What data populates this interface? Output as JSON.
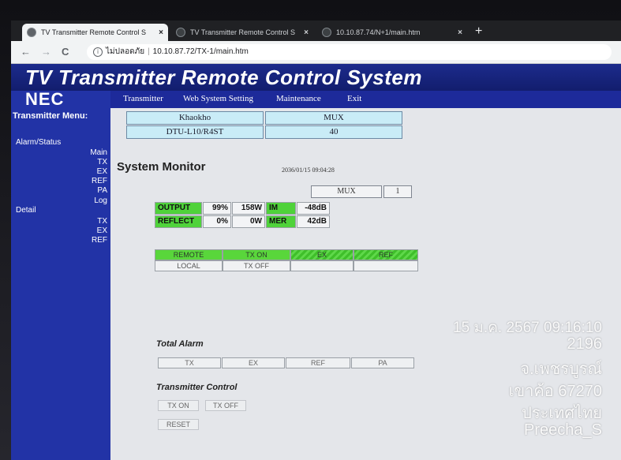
{
  "browser": {
    "tabs": [
      {
        "title": "TV Transmitter Remote Control S",
        "close": "×"
      },
      {
        "title": "TV Transmitter Remote Control S",
        "close": "×"
      },
      {
        "title": "10.10.87.74/N+1/main.htm",
        "close": "×"
      }
    ],
    "new_tab": "+",
    "nav": {
      "back": "←",
      "forward": "→",
      "reload": "C"
    },
    "address": {
      "security_label": "ไม่ปลอดภัย",
      "separator": "|",
      "url": "10.10.87.72/TX-1/main.htm"
    }
  },
  "app": {
    "title": "TV Transmitter Remote Control System",
    "logo": "NEC",
    "menu_heading": "Transmitter Menu:",
    "top_menu": [
      "Transmitter",
      "Web System Setting",
      "Maintenance",
      "Exit"
    ],
    "sidebar": {
      "alarm_status": "Alarm/Status",
      "alarm_items": [
        "Main",
        "TX",
        "EX",
        "REF",
        "PA",
        "Log"
      ],
      "detail": "Detail",
      "detail_items": [
        "TX",
        "EX",
        "REF"
      ]
    }
  },
  "station": {
    "name": "Khaokho",
    "mode": "MUX",
    "model": "DTU-L10/R4ST",
    "channel": "40"
  },
  "monitor": {
    "title": "System Monitor",
    "timestamp": "2036/01/15 09:04:28",
    "mux_label": "MUX",
    "mux_value": "1",
    "output": {
      "label": "OUTPUT",
      "percent": "99%",
      "watts": "158W",
      "key": "IM",
      "value": "-48dB"
    },
    "reflect": {
      "label": "REFLECT",
      "percent": "0%",
      "watts": "0W",
      "key": "MER",
      "value": "42dB"
    },
    "status": {
      "row1": [
        "REMOTE",
        "TX ON",
        "EX",
        "REF"
      ],
      "row2": [
        "LOCAL",
        "TX OFF",
        "",
        ""
      ]
    }
  },
  "total_alarm": {
    "title": "Total Alarm",
    "items": [
      "TX",
      "EX",
      "REF",
      "PA"
    ]
  },
  "control": {
    "title": "Transmitter Control",
    "tx_on": "TX ON",
    "tx_off": "TX OFF",
    "reset": "RESET"
  },
  "overlay": {
    "datetime": "15 ม.ค. 2567 09:16:10",
    "number": "2196",
    "province": "จ.เพชรบูรณ์",
    "area": "เขาค้อ 67270",
    "country": "ประเทศไทย",
    "user": "Preecha_S"
  }
}
